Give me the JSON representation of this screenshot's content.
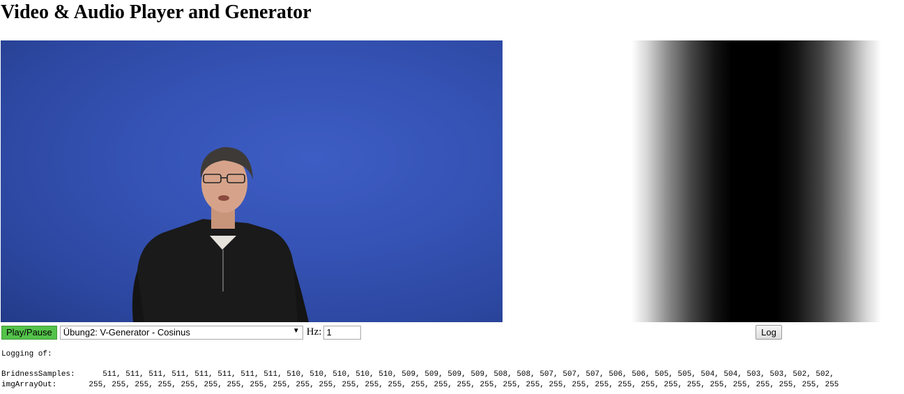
{
  "page": {
    "title": "Video & Audio Player and Generator"
  },
  "controls": {
    "play_label": "Play/Pause",
    "generator_selected": "Übung2: V-Generator - Cosinus",
    "hz_label": "Hz:",
    "hz_value": "1",
    "log_label": "Log"
  },
  "log": {
    "heading": "Logging of:",
    "rows": [
      {
        "label": "BridnessSamples:",
        "values": "      511, 511, 511, 511, 511, 511, 511, 511, 510, 510, 510, 510, 510, 509, 509, 509, 509, 508, 508, 507, 507, 507, 506, 506, 505, 505, 504, 504, 503, 503, 502, 502,"
      },
      {
        "label": "imgArrayOut:",
        "values": "       255, 255, 255, 255, 255, 255, 255, 255, 255, 255, 255, 255, 255, 255, 255, 255, 255, 255, 255, 255, 255, 255, 255, 255, 255, 255, 255, 255, 255, 255, 255, 255, 255"
      }
    ]
  },
  "icons": {
    "dropdown": "chevron-down-icon"
  },
  "colors": {
    "play_button": "#54c24a",
    "video_background": "#3553b5"
  }
}
